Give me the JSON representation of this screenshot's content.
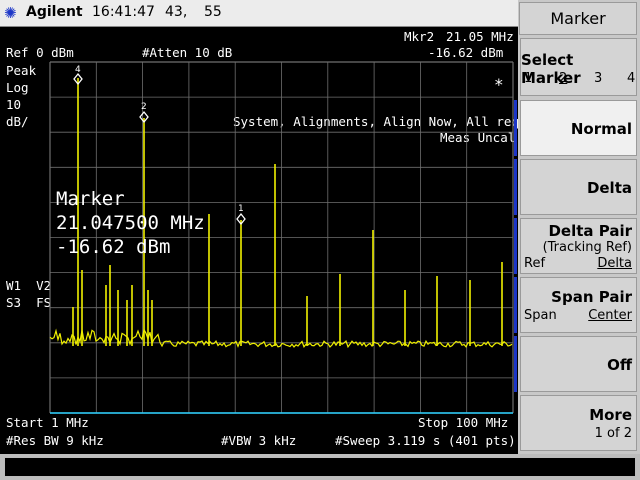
{
  "title_bar": {
    "brand": "Agilent",
    "time": "16:41:47",
    "field1": "43,",
    "field2": "55"
  },
  "screen": {
    "marker_readout": {
      "label": "Mkr2",
      "freq": "21.05 MHz",
      "level": "-16.62 dBm"
    },
    "ref": "Ref 0 dBm",
    "atten": "#Atten 10 dB",
    "scale_lines": [
      "Peak",
      "Log",
      "10",
      "dB/"
    ],
    "alert_lines": [
      "System, Alignments, Align Now, All required",
      "Meas Uncal"
    ],
    "asterisk": "*",
    "marker_box": {
      "title": "Marker",
      "freq": "21.047500 MHz",
      "level": "-16.62 dBm"
    },
    "trace_info": [
      "W1  V2",
      "S3  FS"
    ],
    "start": "Start 1 MHz",
    "stop": "Stop 100 MHz",
    "res_bw": "#Res BW 9 kHz",
    "vbw": "#VBW 3 kHz",
    "sweep": "#Sweep 3.119 s (401 pts)",
    "marker_labels": [
      "4",
      "2",
      "1"
    ],
    "trace_color": "#f0f000",
    "grid_color": "#6f6f6f",
    "baseline_color": "#2ad0ff"
  },
  "softkeys": {
    "menu_title": "Marker",
    "select_marker": {
      "label": "Select Marker",
      "options": [
        "1",
        "2",
        "3",
        "4"
      ],
      "selected": "2"
    },
    "normal": "Normal",
    "delta": "Delta",
    "delta_pair": {
      "label": "Delta Pair",
      "sub": "(Tracking Ref)",
      "left": "Ref",
      "right": "Delta"
    },
    "span_pair": {
      "label": "Span Pair",
      "left": "Span",
      "right": "Center"
    },
    "off": "Off",
    "more": {
      "label": "More",
      "sub": "1 of 2"
    }
  },
  "colors": {
    "softkey_accent": "#1c36c8"
  }
}
